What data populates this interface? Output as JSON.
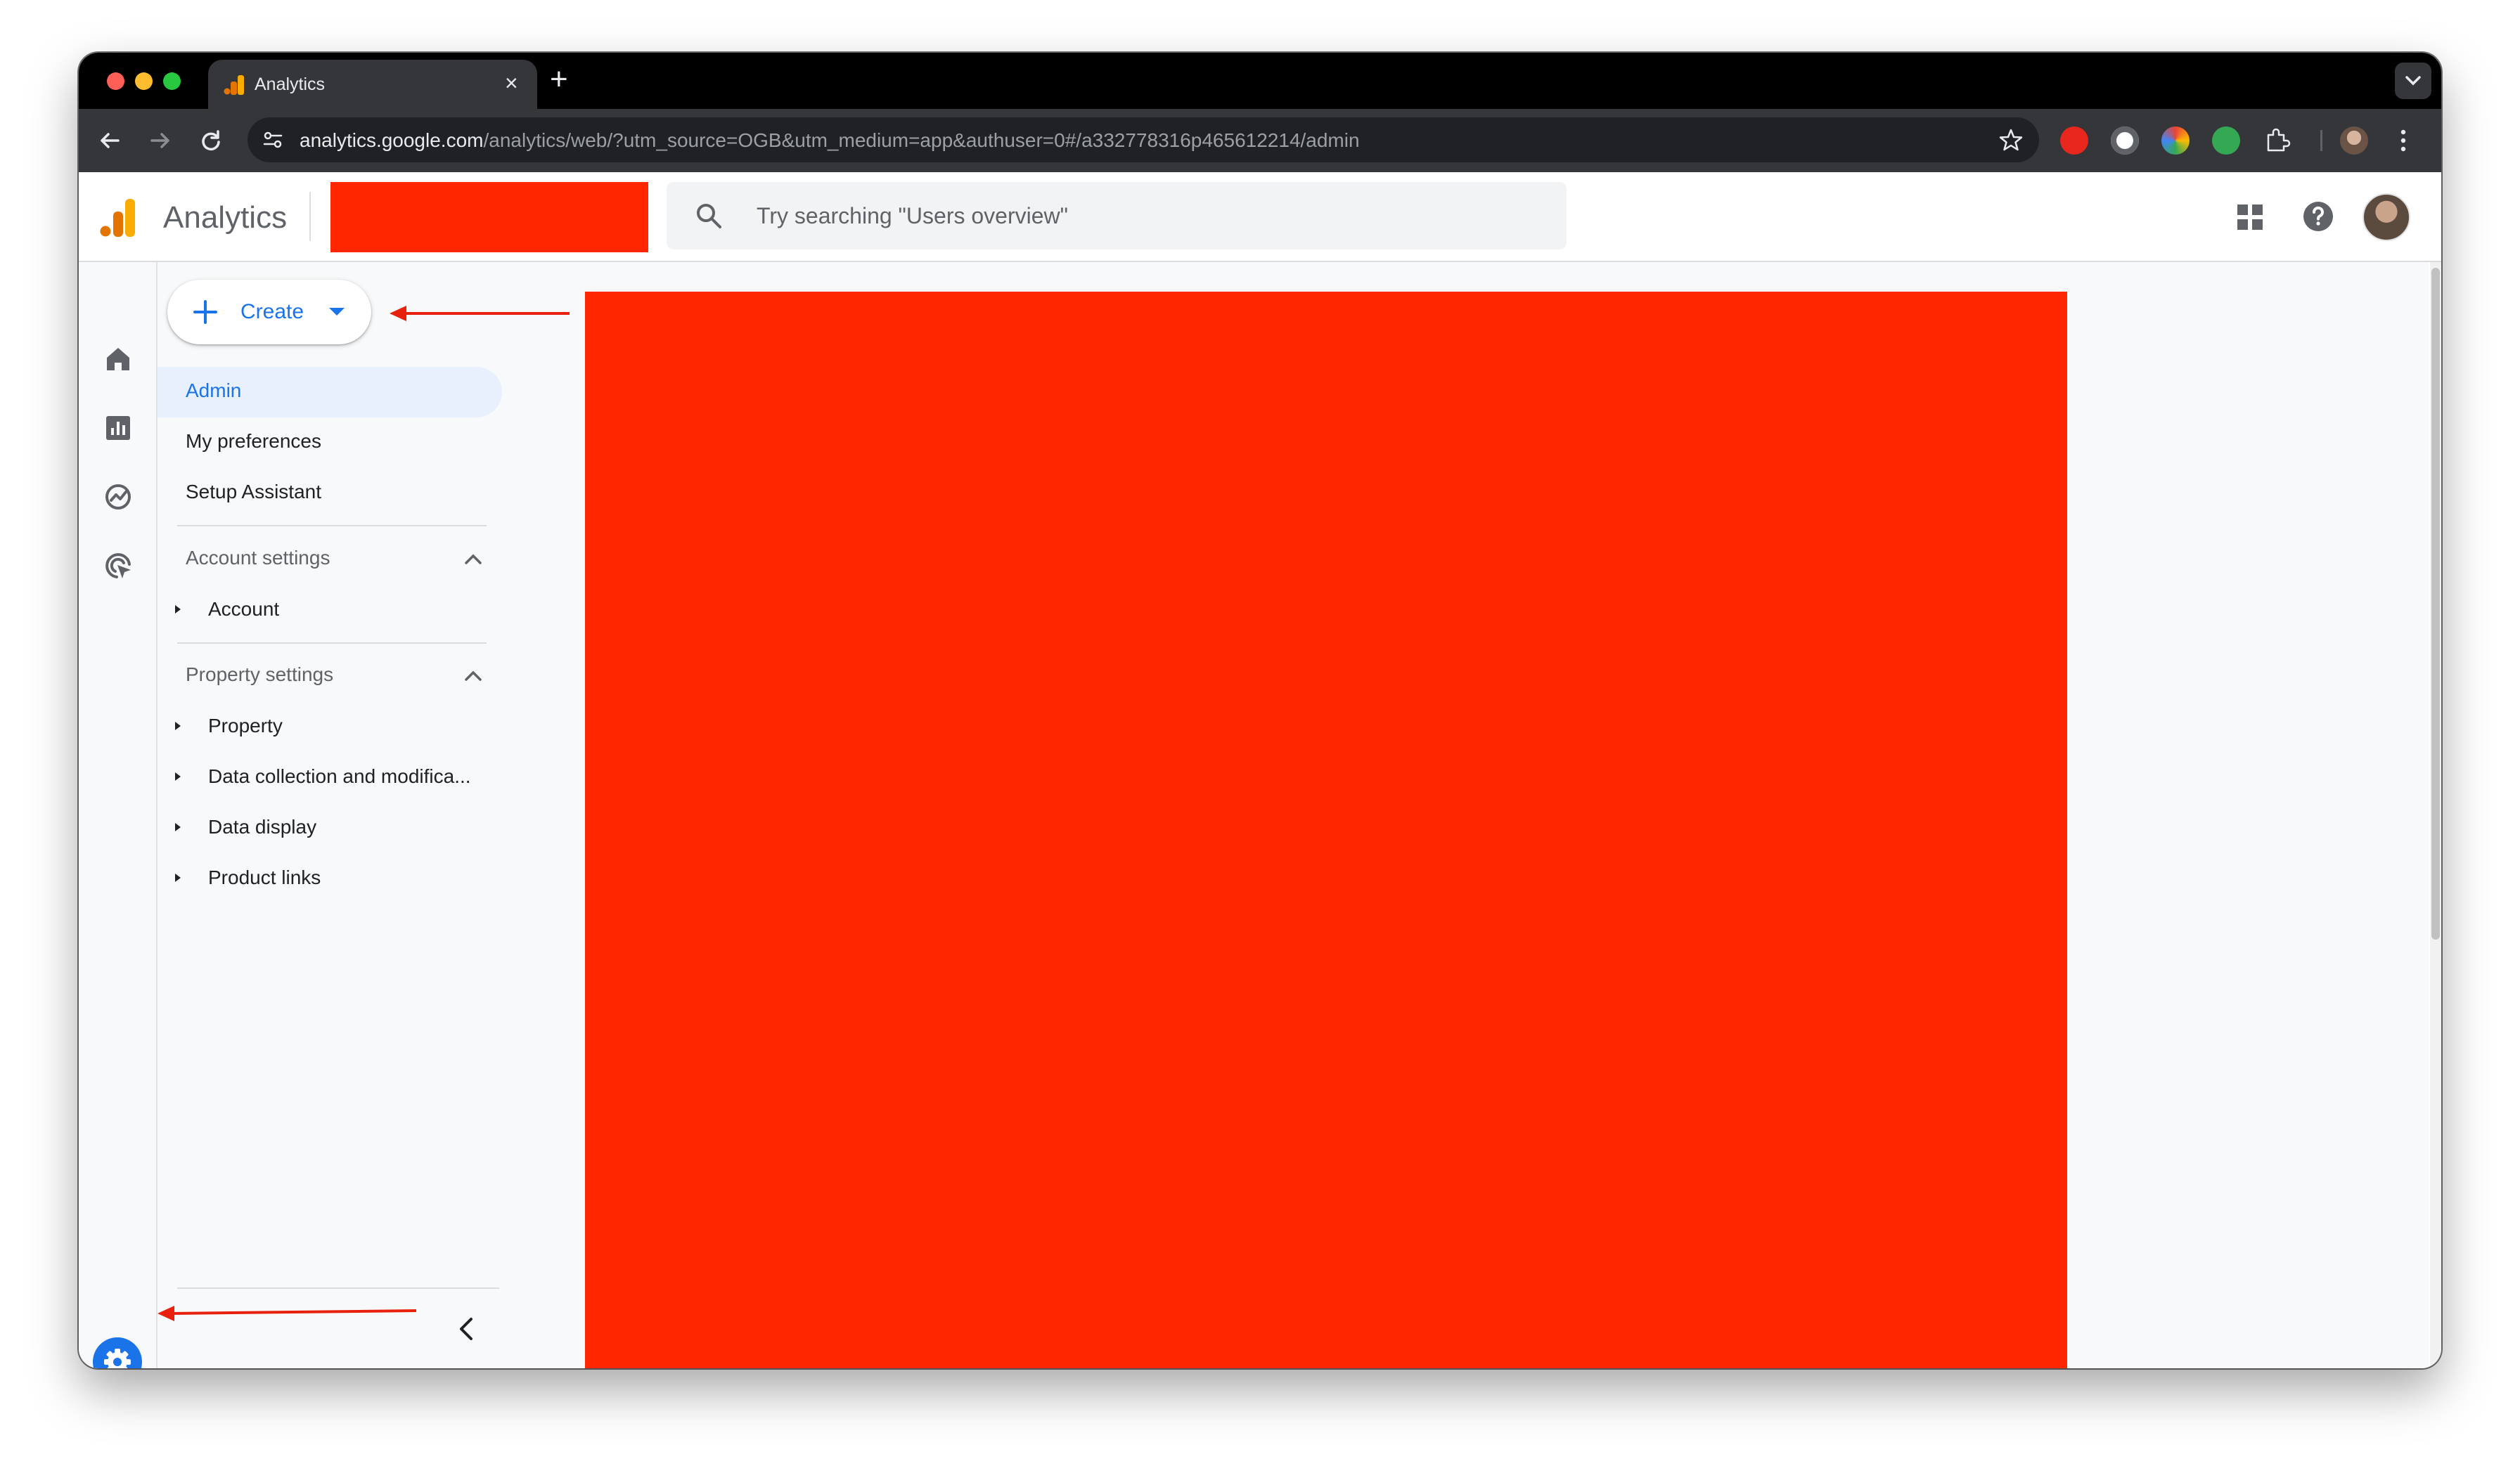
{
  "browser": {
    "tab_title": "Analytics",
    "tab_close": "×",
    "new_tab": "+",
    "url_host": "analytics.google.com",
    "url_path": "/analytics/web/?utm_source=OGB&utm_medium=app&authuser=0#/a332778316p465612214/admin"
  },
  "header": {
    "product_name": "Analytics",
    "search_placeholder": "Try searching \"Users overview\""
  },
  "rail": {
    "icons": [
      "home-icon",
      "reports-icon",
      "explore-icon",
      "advertising-icon"
    ],
    "settings_icon": "gear-icon"
  },
  "sidenav": {
    "create_label": "Create",
    "items": [
      {
        "label": "Admin",
        "active": true
      },
      {
        "label": "My preferences"
      },
      {
        "label": "Setup Assistant"
      }
    ],
    "account_section": {
      "title": "Account settings",
      "items": [
        "Account"
      ]
    },
    "property_section": {
      "title": "Property settings",
      "items": [
        "Property",
        "Data collection and modifica...",
        "Data display",
        "Product links"
      ]
    }
  },
  "colors": {
    "accent": "#1a73e8",
    "active_bg": "#e8f0fe",
    "redaction": "#ff2600",
    "annotation_arrow": "#e8210e"
  }
}
